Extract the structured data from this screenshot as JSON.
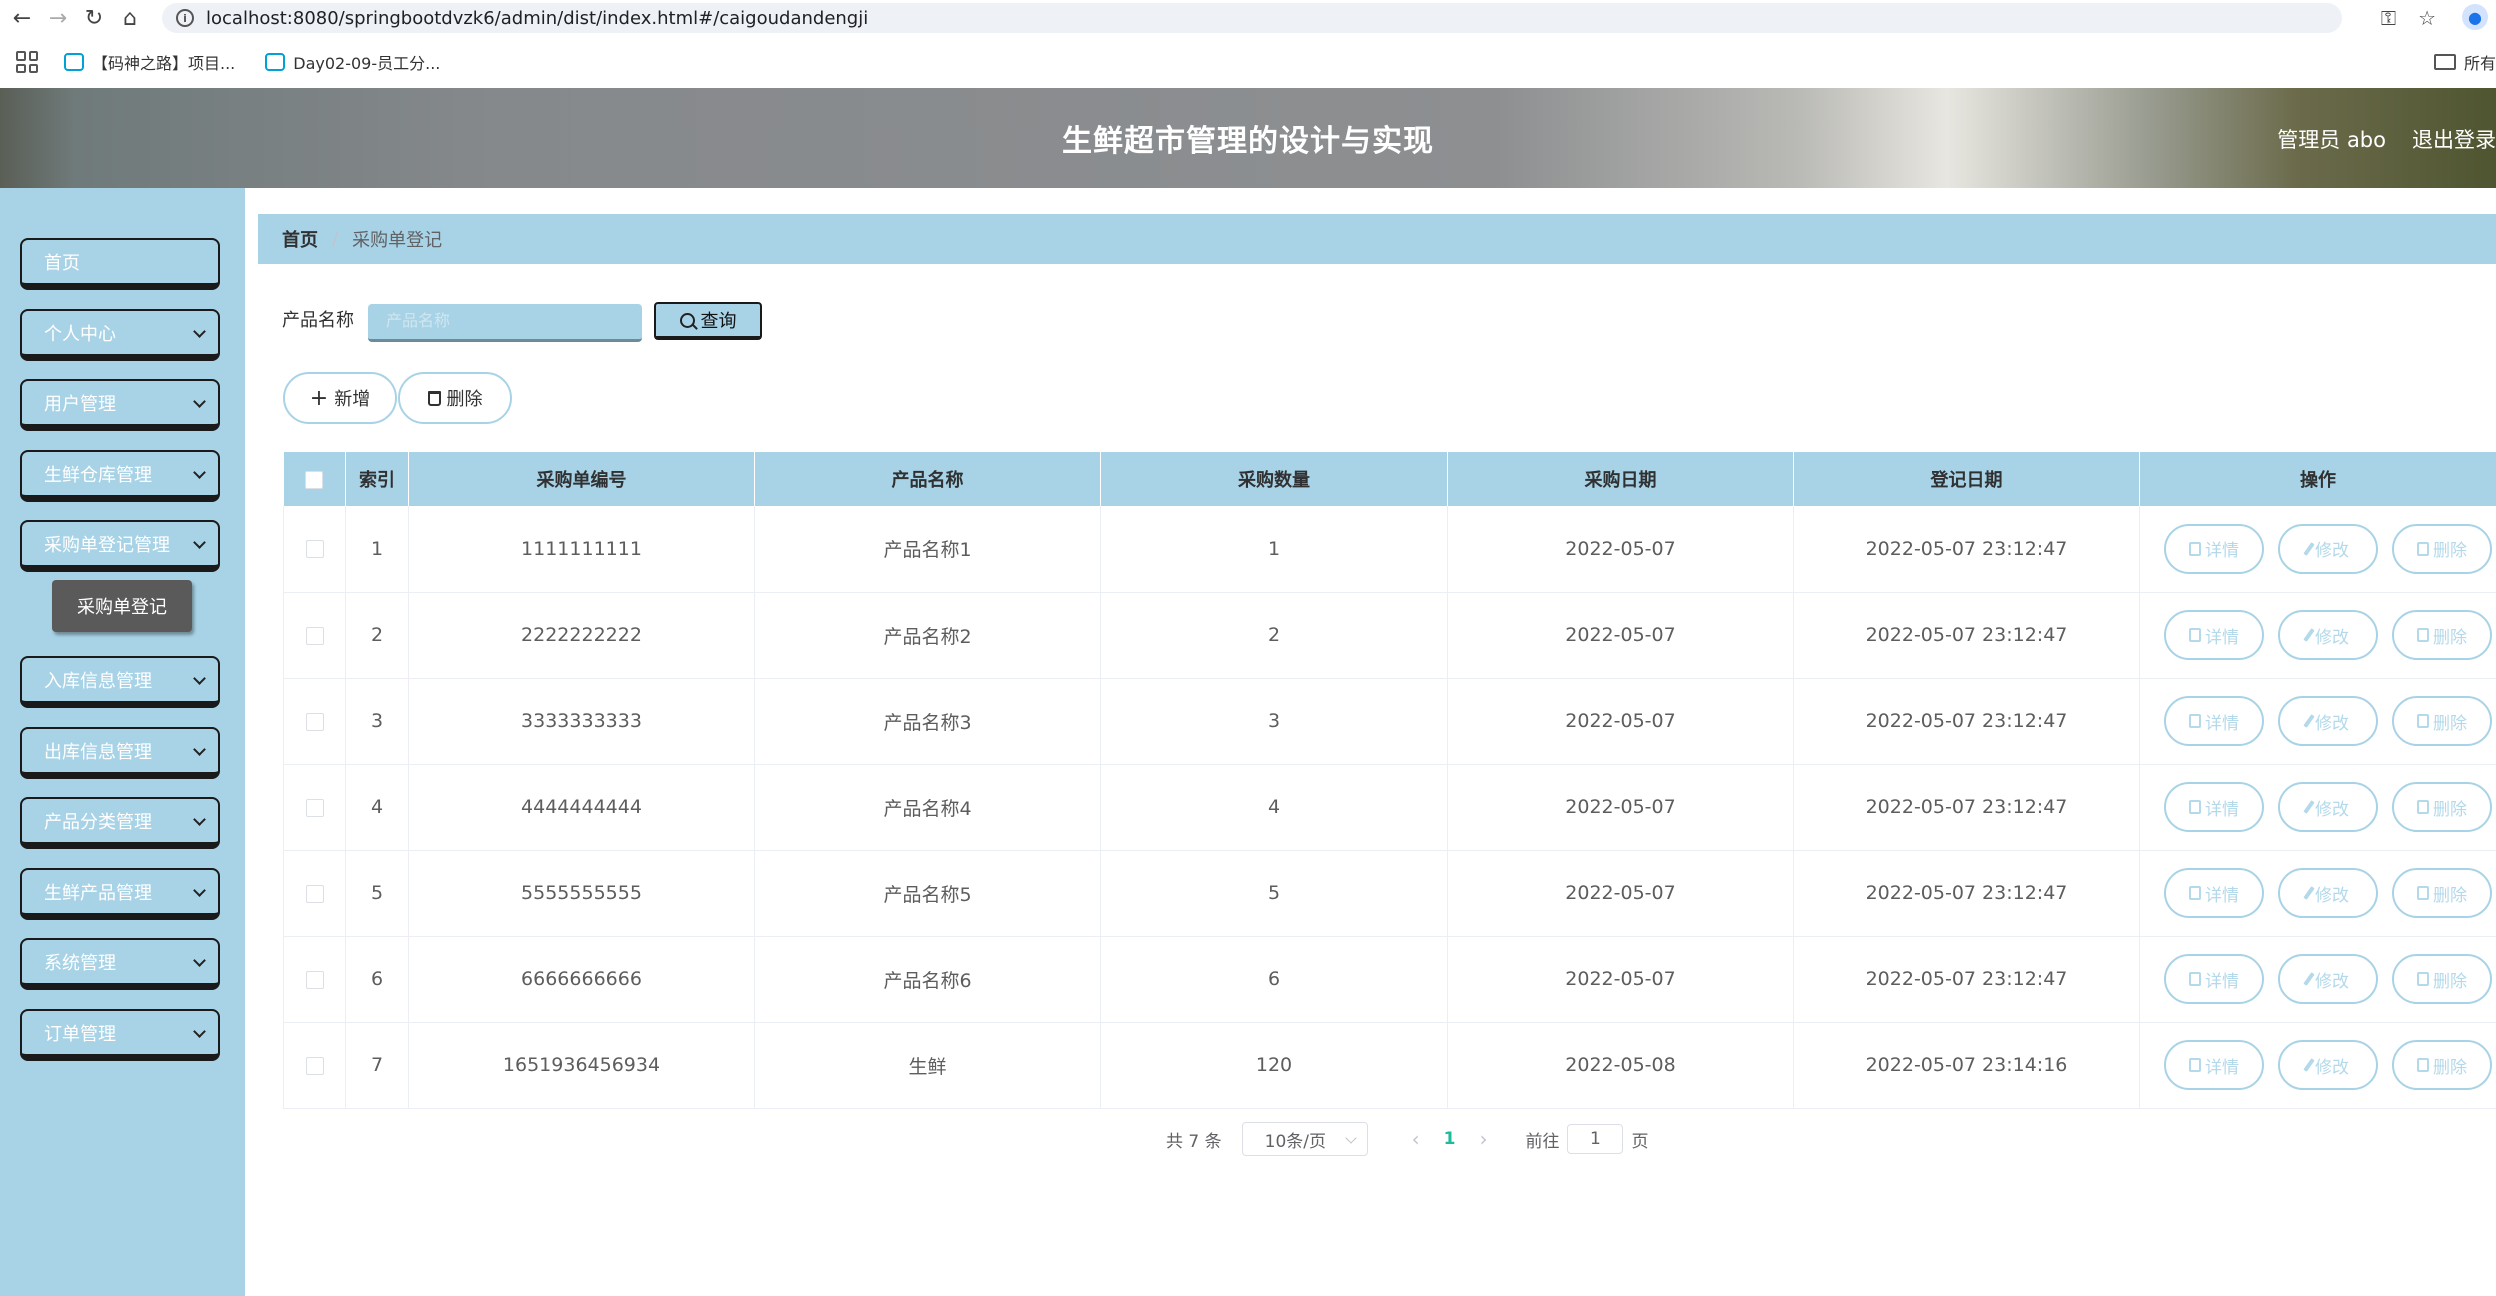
{
  "browser": {
    "url": "localhost:8080/springbootdvzk6/admin/dist/index.html#/caigoudandengji",
    "bookmarks": [
      "【码神之路】项目...",
      "Day02-09-员工分..."
    ],
    "bookmarks_folder": "所有"
  },
  "header": {
    "title": "生鲜超市管理的设计与实现",
    "user": "管理员 abo",
    "logout": "退出登录"
  },
  "sidebar": {
    "items": [
      {
        "label": "首页"
      },
      {
        "label": "个人中心"
      },
      {
        "label": "用户管理"
      },
      {
        "label": "生鲜仓库管理"
      },
      {
        "label": "采购单登记管理"
      },
      {
        "label": "入库信息管理"
      },
      {
        "label": "出库信息管理"
      },
      {
        "label": "产品分类管理"
      },
      {
        "label": "生鲜产品管理"
      },
      {
        "label": "系统管理"
      },
      {
        "label": "订单管理"
      }
    ],
    "sub_item": "采购单登记"
  },
  "breadcrumb": {
    "home": "首页",
    "current": "采购单登记"
  },
  "search": {
    "label": "产品名称",
    "placeholder": "产品名称",
    "button": "查询"
  },
  "actions": {
    "add": "新增",
    "delete": "删除"
  },
  "table": {
    "headers": [
      "索引",
      "采购单编号",
      "产品名称",
      "采购数量",
      "采购日期",
      "登记日期",
      "操作"
    ],
    "rows": [
      {
        "index": "1",
        "code": "1111111111",
        "product": "产品名称1",
        "qty": "1",
        "buy_date": "2022-05-07",
        "reg_date": "2022-05-07 23:12:47"
      },
      {
        "index": "2",
        "code": "2222222222",
        "product": "产品名称2",
        "qty": "2",
        "buy_date": "2022-05-07",
        "reg_date": "2022-05-07 23:12:47"
      },
      {
        "index": "3",
        "code": "3333333333",
        "product": "产品名称3",
        "qty": "3",
        "buy_date": "2022-05-07",
        "reg_date": "2022-05-07 23:12:47"
      },
      {
        "index": "4",
        "code": "4444444444",
        "product": "产品名称4",
        "qty": "4",
        "buy_date": "2022-05-07",
        "reg_date": "2022-05-07 23:12:47"
      },
      {
        "index": "5",
        "code": "5555555555",
        "product": "产品名称5",
        "qty": "5",
        "buy_date": "2022-05-07",
        "reg_date": "2022-05-07 23:12:47"
      },
      {
        "index": "6",
        "code": "6666666666",
        "product": "产品名称6",
        "qty": "6",
        "buy_date": "2022-05-07",
        "reg_date": "2022-05-07 23:12:47"
      },
      {
        "index": "7",
        "code": "1651936456934",
        "product": "生鲜",
        "qty": "120",
        "buy_date": "2022-05-08",
        "reg_date": "2022-05-07 23:14:16"
      }
    ],
    "ops": {
      "detail": "详情",
      "edit": "修改",
      "delete": "删除"
    }
  },
  "pagination": {
    "total": "共 7 条",
    "page_size": "10条/页",
    "current_page": "1",
    "goto_label": "前往",
    "goto_value": "1",
    "page_suffix": "页"
  },
  "colors": {
    "accent": "#a8d3e6",
    "active_page": "#1abc9c",
    "submenu": "#5a5a5a"
  }
}
